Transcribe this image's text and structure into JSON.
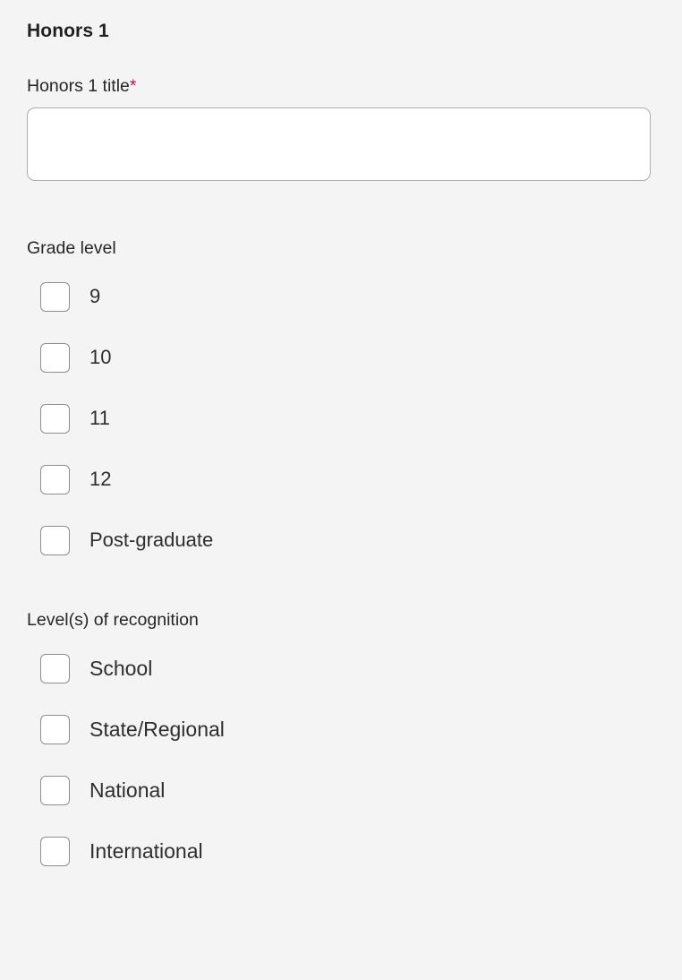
{
  "section": {
    "title": "Honors 1"
  },
  "title_field": {
    "label": "Honors 1 title",
    "required_marker": "*",
    "value": "",
    "placeholder": ""
  },
  "grade_level": {
    "label": "Grade level",
    "options": [
      {
        "label": "9",
        "checked": false
      },
      {
        "label": "10",
        "checked": false
      },
      {
        "label": "11",
        "checked": false
      },
      {
        "label": "12",
        "checked": false
      },
      {
        "label": "Post-graduate",
        "checked": false
      }
    ]
  },
  "recognition": {
    "label": "Level(s) of recognition",
    "options": [
      {
        "label": "School",
        "checked": false
      },
      {
        "label": "State/Regional",
        "checked": false
      },
      {
        "label": "National",
        "checked": false
      },
      {
        "label": "International",
        "checked": false
      }
    ]
  },
  "colors": {
    "background": "#f4f4f4",
    "text": "#2b2b2b",
    "required": "#cc1144",
    "border": "#8e8e8e",
    "input_border": "#adadad",
    "input_background": "#ffffff"
  }
}
